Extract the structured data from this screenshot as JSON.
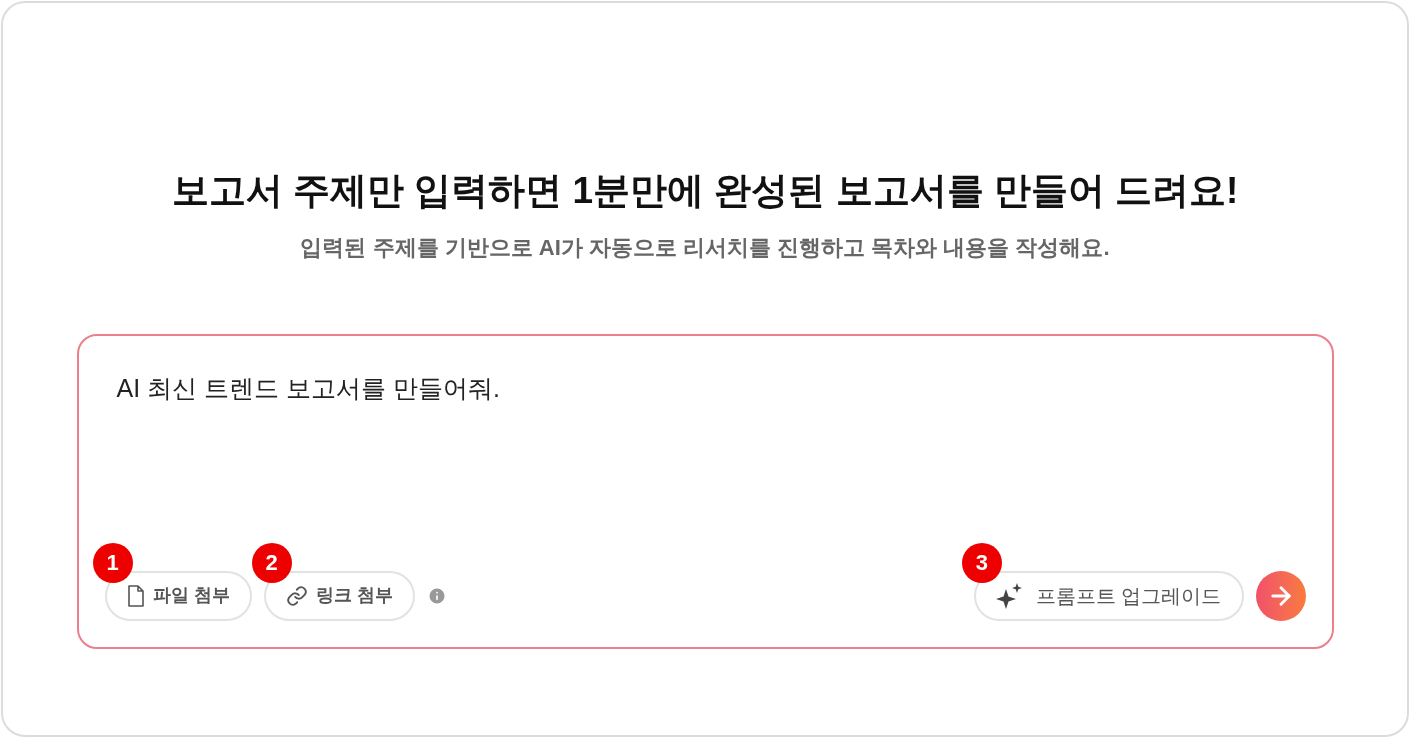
{
  "heading": "보고서 주제만 입력하면 1분만에 완성된 보고서를 만들어 드려요!",
  "subtitle": "입력된 주제를 기반으로 AI가 자동으로 리서치를 진행하고 목차와 내용을 작성해요.",
  "prompt": {
    "value": "AI 최신 트렌드 보고서를 만들어줘."
  },
  "left_buttons": [
    {
      "kind": "file",
      "label": "파일 첨부",
      "marker": "1"
    },
    {
      "kind": "link",
      "label": "링크 첨부",
      "marker": "2"
    }
  ],
  "upgrade_button": {
    "label": "프롬프트 업그레이드",
    "marker": "3"
  }
}
